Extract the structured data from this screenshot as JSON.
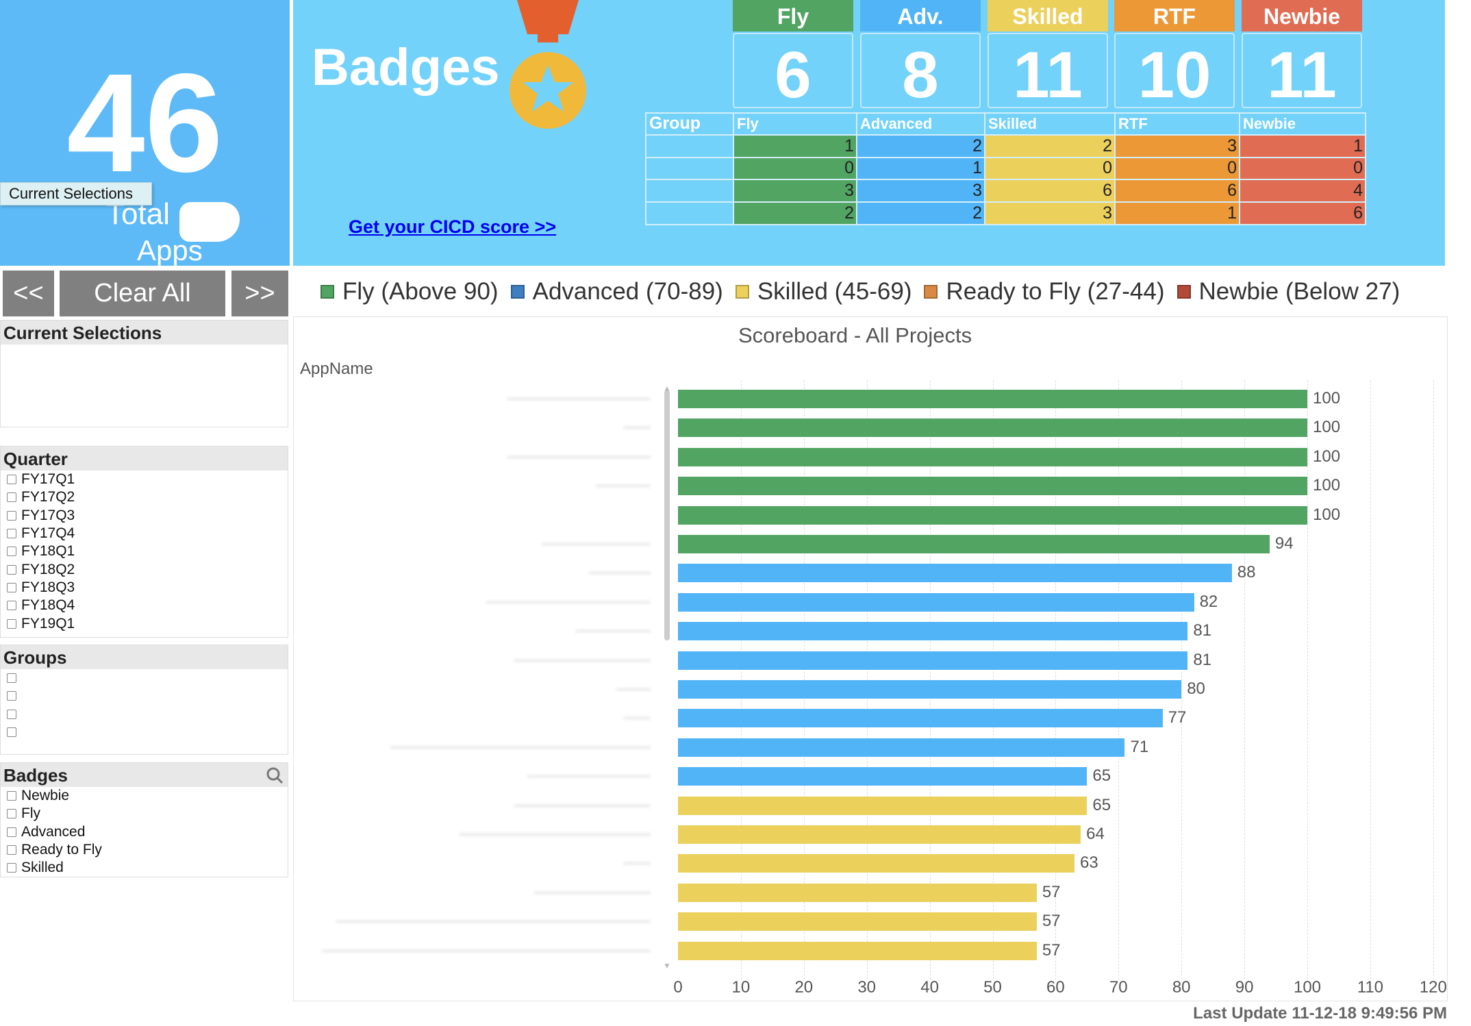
{
  "summary": {
    "total": "46",
    "total_label": "Total",
    "apps_label": "Apps",
    "tooltip": "Current Selections"
  },
  "badges": {
    "title": "Badges",
    "link": "Get your CICD score >>",
    "cards": [
      {
        "label": "Fly",
        "count": "6",
        "color": "#52a463"
      },
      {
        "label": "Adv.",
        "count": "8",
        "color": "#51b4f7"
      },
      {
        "label": "Skilled",
        "count": "11",
        "color": "#ecd05c"
      },
      {
        "label": "RTF",
        "count": "10",
        "color": "#ec9837"
      },
      {
        "label": "Newbie",
        "count": "11",
        "color": "#e06c54"
      }
    ],
    "table": {
      "headers": [
        "Group",
        "Fly",
        "Advanced",
        "Skilled",
        "RTF",
        "Newbie"
      ],
      "rows": [
        [
          "1",
          "2",
          "2",
          "3",
          "1"
        ],
        [
          "0",
          "1",
          "0",
          "0",
          "0"
        ],
        [
          "3",
          "3",
          "6",
          "6",
          "4"
        ],
        [
          "2",
          "2",
          "3",
          "1",
          "6"
        ]
      ]
    }
  },
  "nav": {
    "prev": "<<",
    "clear": "Clear All",
    "next": ">>"
  },
  "legend": [
    {
      "label": "Fly (Above 90)",
      "color": "#52a463"
    },
    {
      "label": "Advanced (70-89)",
      "color": "#3d7fc0"
    },
    {
      "label": "Skilled (45-69)",
      "color": "#ecd05c"
    },
    {
      "label": "Ready to Fly (27-44)",
      "color": "#d88a45"
    },
    {
      "label": "Newbie (Below 27)",
      "color": "#b24a3a"
    }
  ],
  "filters": {
    "current_selections": "Current Selections",
    "quarter": {
      "title": "Quarter",
      "items": [
        "FY17Q1",
        "FY17Q2",
        "FY17Q3",
        "FY17Q4",
        "FY18Q1",
        "FY18Q2",
        "FY18Q3",
        "FY18Q4",
        "FY19Q1"
      ]
    },
    "groups": {
      "title": "Groups"
    },
    "badges": {
      "title": "Badges",
      "items": [
        "Newbie",
        "Fly",
        "Advanced",
        "Ready to Fly",
        "Skilled"
      ]
    }
  },
  "chart_data": {
    "type": "bar",
    "orientation": "horizontal",
    "title": "Scoreboard -  All Projects",
    "ylabel": "AppName",
    "xlim": [
      0,
      120
    ],
    "xticks": [
      "0",
      "10",
      "20",
      "30",
      "40",
      "50",
      "60",
      "70",
      "80",
      "90",
      "100",
      "110",
      "120"
    ],
    "values": [
      100,
      100,
      100,
      100,
      100,
      94,
      88,
      82,
      81,
      81,
      80,
      77,
      71,
      65,
      65,
      64,
      63,
      57,
      57,
      57
    ],
    "badge": [
      "fly",
      "fly",
      "fly",
      "fly",
      "fly",
      "fly",
      "adv",
      "adv",
      "adv",
      "adv",
      "adv",
      "adv",
      "adv",
      "adv",
      "skl",
      "skl",
      "skl",
      "skl",
      "skl",
      "skl"
    ],
    "colors": {
      "fly": "#52a463",
      "adv": "#51b4f7",
      "skl": "#ecd05c"
    }
  },
  "footer": {
    "last_update": "Last Update 11-12-18 9:49:56 PM"
  }
}
